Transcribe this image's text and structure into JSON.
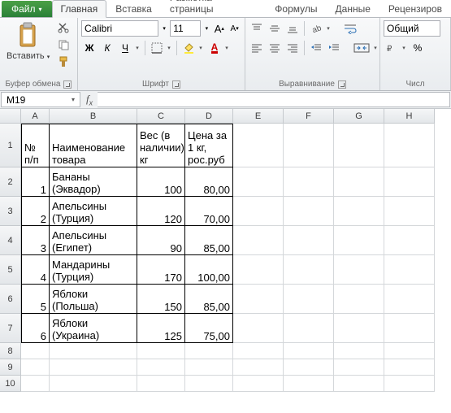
{
  "tabs": {
    "file": "Файл",
    "home": "Главная",
    "insert": "Вставка",
    "layout": "Разметка страницы",
    "formulas": "Формулы",
    "data": "Данные",
    "review": "Рецензиров"
  },
  "ribbon": {
    "clipboard": {
      "paste": "Вставить",
      "label": "Буфер обмена"
    },
    "font": {
      "name": "Calibri",
      "size": "11",
      "bold": "Ж",
      "italic": "К",
      "underline": "Ч",
      "label": "Шрифт",
      "grow": "A",
      "shrink": "A"
    },
    "align": {
      "label": "Выравнивание"
    },
    "number": {
      "format": "Общий",
      "label": "Числ"
    }
  },
  "namebox": "M19",
  "headers": {
    "A": "A",
    "B": "B",
    "C": "C",
    "D": "D",
    "E": "E",
    "F": "F",
    "G": "G",
    "H": "H"
  },
  "table": {
    "head": {
      "n": "№ п/п",
      "name": "Наименование товара",
      "weight": "Вес (в наличии), кг",
      "price": "Цена за 1 кг, рос.руб"
    },
    "rows": [
      {
        "n": "1",
        "name": "Бананы (Эквадор)",
        "w": "100",
        "p": "80,00"
      },
      {
        "n": "2",
        "name": "Апельсины (Турция)",
        "w": "120",
        "p": "70,00"
      },
      {
        "n": "3",
        "name": "Апельсины (Египет)",
        "w": "90",
        "p": "85,00"
      },
      {
        "n": "4",
        "name": "Мандарины (Турция)",
        "w": "170",
        "p": "100,00"
      },
      {
        "n": "5",
        "name": "Яблоки (Польша)",
        "w": "150",
        "p": "85,00"
      },
      {
        "n": "6",
        "name": "Яблоки (Украина)",
        "w": "125",
        "p": "75,00"
      }
    ]
  },
  "rownums": [
    "1",
    "2",
    "3",
    "4",
    "5",
    "6",
    "7",
    "8",
    "9",
    "10"
  ]
}
